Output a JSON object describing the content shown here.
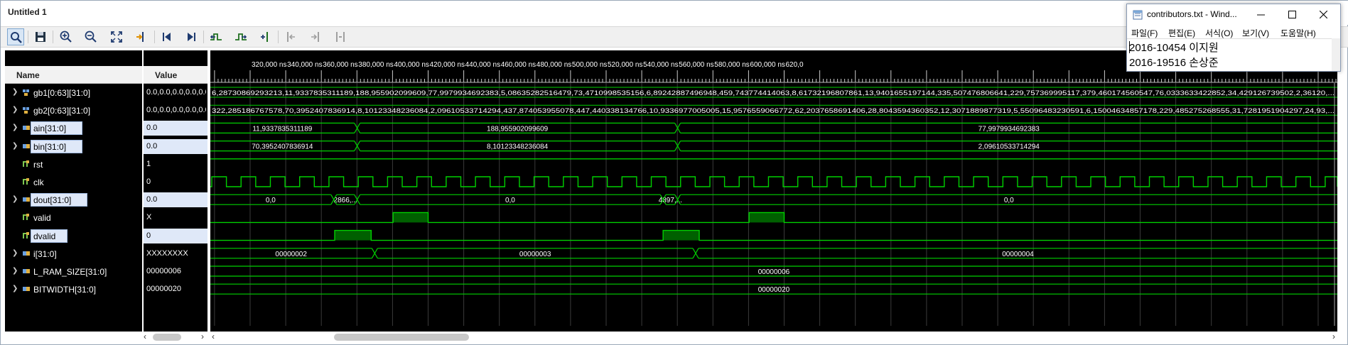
{
  "window": {
    "title": "Untitled 1"
  },
  "toolbar": {
    "buttons": [
      "select-icon",
      "save-icon",
      "zoom-in-icon",
      "zoom-out-icon",
      "zoom-fit-icon",
      "go-to-cursor-icon",
      "go-to-time-zero-icon",
      "go-to-last-time-icon",
      "previous-transition-icon",
      "next-transition-icon",
      "add-marker-icon",
      "previous-marker-icon",
      "next-marker-icon",
      "swap-cursors-icon"
    ]
  },
  "columns": {
    "name": "Name",
    "value": "Value"
  },
  "signals": [
    {
      "name": "gb1[0:63][31:0]",
      "value": "0.0,0.0,0.0,0.0,0.0,0.0,0.0,0.0",
      "type": "array",
      "expandable": true
    },
    {
      "name": "gb2[0:63][31:0]",
      "value": "0.0,0.0,0.0,0.0,0.0,0.0,0.0,0.0",
      "type": "array",
      "expandable": true
    },
    {
      "name": "ain[31:0]",
      "value": "0.0",
      "type": "bus",
      "expandable": true,
      "highlighted": true
    },
    {
      "name": "bin[31:0]",
      "value": "0.0",
      "type": "bus",
      "expandable": true,
      "highlighted": true
    },
    {
      "name": "rst",
      "value": "1",
      "type": "bit",
      "expandable": false
    },
    {
      "name": "clk",
      "value": "0",
      "type": "bit",
      "expandable": false
    },
    {
      "name": "dout[31:0]",
      "value": "0.0",
      "type": "bus",
      "expandable": true,
      "highlighted": true
    },
    {
      "name": "valid",
      "value": "X",
      "type": "bit",
      "expandable": false
    },
    {
      "name": "dvalid",
      "value": "0",
      "type": "bit",
      "expandable": false,
      "highlighted": true
    },
    {
      "name": "i[31:0]",
      "value": "XXXXXXXX",
      "type": "bus",
      "expandable": true
    },
    {
      "name": "L_RAM_SIZE[31:0]",
      "value": "00000006",
      "type": "bus",
      "expandable": true
    },
    {
      "name": "BITWIDTH[31:0]",
      "value": "00000020",
      "type": "bus",
      "expandable": true
    }
  ],
  "timeline": {
    "ticks": [
      "320,000 ns",
      "340,000 ns",
      "360,000 ns",
      "380,000 ns",
      "400,000 ns",
      "420,000 ns",
      "440,000 ns",
      "460,000 ns",
      "480,000 ns",
      "500,000 ns",
      "520,000 ns",
      "540,000 ns",
      "560,000 ns",
      "580,000 ns",
      "600,000 ns",
      "620,0"
    ],
    "first_tick_ns": 320000,
    "tick_step_ns": 20000
  },
  "waves": {
    "gb1_text": "6,28730869293213,11,9337835311189,188,955902099609,77,9979934692383,5,08635282516479,73,4710998535156,6,89242887496948,459,743774414063,8,61732196807861,13,9401655197144,335,507476806641,229,757369995117,379,460174560547,76,0333633422852,34,429126739502,2,36120,...",
    "gb2_text": "322,285186767578,70,3952407836914,8,10123348236084,2,09610533714294,437,874053955078,447,440338134766,10,9336977005005,15,9576559066772,62,2037658691406,28,8043594360352,12,3071889877319,5,55096483230591,6,15004634857178,229,485275268555,31,7281951904297,24,93,...",
    "ain_values": [
      "11,9337835311189",
      "188,955902099609",
      "77,9979934692383"
    ],
    "bin_values": [
      "70,3952407836914",
      "8,10123348236084",
      "2,09610533714294"
    ],
    "dout_values": [
      "0,0",
      "2866,...",
      "0,0",
      "4397,...",
      "0,0"
    ],
    "i_values": [
      "00000002",
      "00000003",
      "00000004"
    ],
    "l_ram_size": "00000006",
    "bitwidth": "00000020"
  },
  "notepad": {
    "title": "contributors.txt - Wind...",
    "menu": [
      "파일(F)",
      "편집(E)",
      "서식(O)",
      "보기(V)",
      "도움말(H)"
    ],
    "lines": [
      "2016-10454 이지원",
      "2016-19516 손상준"
    ]
  },
  "colors": {
    "wave": "#00d000",
    "grid": "#3a3a3a",
    "background": "#000000",
    "highlight": "#dfe8f8"
  }
}
